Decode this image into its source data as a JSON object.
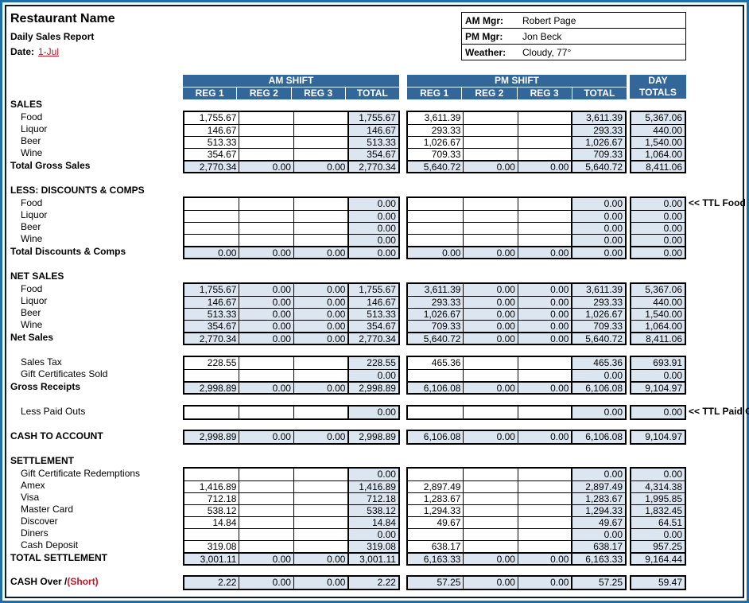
{
  "header": {
    "title": "Restaurant Name",
    "subtitle": "Daily Sales Report",
    "date_label": "Date:",
    "date_value": "1-Jul"
  },
  "info": [
    {
      "key": "AM Mgr:",
      "value": "Robert Page"
    },
    {
      "key": "PM Mgr:",
      "value": "Jon Beck"
    },
    {
      "key": "Weather:",
      "value": "Cloudy, 77°"
    }
  ],
  "columns": {
    "am_shift": "AM SHIFT",
    "pm_shift": "PM SHIFT",
    "day_top": "DAY",
    "day_bottom": "TOTALS",
    "sub": [
      "REG 1",
      "REG 2",
      "REG 3",
      "TOTAL"
    ]
  },
  "colors": {
    "header_bg": "#336699",
    "shade": "#dce6f1",
    "accent_red": "#c0182a",
    "frame": "#1e6fa8"
  },
  "sections": {
    "sales": {
      "heading": "SALES",
      "rows": [
        {
          "label": "Food",
          "am": [
            "1,755.67",
            "",
            "",
            "1,755.67"
          ],
          "pm": [
            "3,611.39",
            "",
            "",
            "3,611.39"
          ],
          "day": "5,367.06"
        },
        {
          "label": "Liquor",
          "am": [
            "146.67",
            "",
            "",
            "146.67"
          ],
          "pm": [
            "293.33",
            "",
            "",
            "293.33"
          ],
          "day": "440.00"
        },
        {
          "label": "Beer",
          "am": [
            "513.33",
            "",
            "",
            "513.33"
          ],
          "pm": [
            "1,026.67",
            "",
            "",
            "1,026.67"
          ],
          "day": "1,540.00"
        },
        {
          "label": "Wine",
          "am": [
            "354.67",
            "",
            "",
            "354.67"
          ],
          "pm": [
            "709.33",
            "",
            "",
            "709.33"
          ],
          "day": "1,064.00"
        }
      ],
      "total": {
        "label": "Total Gross Sales",
        "am": [
          "2,770.34",
          "0.00",
          "0.00",
          "2,770.34"
        ],
        "pm": [
          "5,640.72",
          "0.00",
          "0.00",
          "5,640.72"
        ],
        "day": "8,411.06"
      }
    },
    "discounts": {
      "heading": "LESS: DISCOUNTS & COMPS",
      "note": "<< TTL Food",
      "rows": [
        {
          "label": "Food",
          "am": [
            "",
            "",
            "",
            "0.00"
          ],
          "pm": [
            "",
            "",
            "",
            "0.00"
          ],
          "day": "0.00"
        },
        {
          "label": "Liquor",
          "am": [
            "",
            "",
            "",
            "0.00"
          ],
          "pm": [
            "",
            "",
            "",
            "0.00"
          ],
          "day": "0.00"
        },
        {
          "label": "Beer",
          "am": [
            "",
            "",
            "",
            "0.00"
          ],
          "pm": [
            "",
            "",
            "",
            "0.00"
          ],
          "day": "0.00"
        },
        {
          "label": "Wine",
          "am": [
            "",
            "",
            "",
            "0.00"
          ],
          "pm": [
            "",
            "",
            "",
            "0.00"
          ],
          "day": "0.00"
        }
      ],
      "total": {
        "label": "Total Discounts & Comps",
        "am": [
          "0.00",
          "0.00",
          "0.00",
          "0.00"
        ],
        "pm": [
          "0.00",
          "0.00",
          "0.00",
          "0.00"
        ],
        "day": "0.00"
      }
    },
    "net_sales": {
      "heading": "NET SALES",
      "rows": [
        {
          "label": "Food",
          "am": [
            "1,755.67",
            "0.00",
            "0.00",
            "1,755.67"
          ],
          "pm": [
            "3,611.39",
            "0.00",
            "0.00",
            "3,611.39"
          ],
          "day": "5,367.06"
        },
        {
          "label": "Liquor",
          "am": [
            "146.67",
            "0.00",
            "0.00",
            "146.67"
          ],
          "pm": [
            "293.33",
            "0.00",
            "0.00",
            "293.33"
          ],
          "day": "440.00"
        },
        {
          "label": "Beer",
          "am": [
            "513.33",
            "0.00",
            "0.00",
            "513.33"
          ],
          "pm": [
            "1,026.67",
            "0.00",
            "0.00",
            "1,026.67"
          ],
          "day": "1,540.00"
        },
        {
          "label": "Wine",
          "am": [
            "354.67",
            "0.00",
            "0.00",
            "354.67"
          ],
          "pm": [
            "709.33",
            "0.00",
            "0.00",
            "709.33"
          ],
          "day": "1,064.00"
        }
      ],
      "total": {
        "label": "Net Sales",
        "am": [
          "2,770.34",
          "0.00",
          "0.00",
          "2,770.34"
        ],
        "pm": [
          "5,640.72",
          "0.00",
          "0.00",
          "5,640.72"
        ],
        "day": "8,411.06"
      }
    },
    "receipts": {
      "rows": [
        {
          "label": "Sales Tax",
          "am": [
            "228.55",
            "",
            "",
            "228.55"
          ],
          "pm": [
            "465.36",
            "",
            "",
            "465.36"
          ],
          "day": "693.91"
        },
        {
          "label": "Gift Certificates Sold",
          "am": [
            "",
            "",
            "",
            "0.00"
          ],
          "pm": [
            "",
            "",
            "",
            "0.00"
          ],
          "day": "0.00"
        }
      ],
      "total": {
        "label": "Gross Receipts",
        "am": [
          "2,998.89",
          "0.00",
          "0.00",
          "2,998.89"
        ],
        "pm": [
          "6,106.08",
          "0.00",
          "0.00",
          "6,106.08"
        ],
        "day": "9,104.97"
      }
    },
    "paid_outs": {
      "label": "Less Paid Outs",
      "note": "<< TTL Paid O",
      "am": [
        "",
        "",
        "",
        "0.00"
      ],
      "pm": [
        "",
        "",
        "",
        "0.00"
      ],
      "day": "0.00"
    },
    "cash_to_account": {
      "label": "CASH TO ACCOUNT",
      "am": [
        "2,998.89",
        "0.00",
        "0.00",
        "2,998.89"
      ],
      "pm": [
        "6,106.08",
        "0.00",
        "0.00",
        "6,106.08"
      ],
      "day": "9,104.97"
    },
    "settlement": {
      "heading": "SETTLEMENT",
      "rows": [
        {
          "label": "Gift Certificate Redemptions",
          "am": [
            "",
            "",
            "",
            "0.00"
          ],
          "pm": [
            "",
            "",
            "",
            "0.00"
          ],
          "day": "0.00"
        },
        {
          "label": "Amex",
          "am": [
            "1,416.89",
            "",
            "",
            "1,416.89"
          ],
          "pm": [
            "2,897.49",
            "",
            "",
            "2,897.49"
          ],
          "day": "4,314.38"
        },
        {
          "label": "Visa",
          "am": [
            "712.18",
            "",
            "",
            "712.18"
          ],
          "pm": [
            "1,283.67",
            "",
            "",
            "1,283.67"
          ],
          "day": "1,995.85"
        },
        {
          "label": "Master Card",
          "am": [
            "538.12",
            "",
            "",
            "538.12"
          ],
          "pm": [
            "1,294.33",
            "",
            "",
            "1,294.33"
          ],
          "day": "1,832.45"
        },
        {
          "label": "Discover",
          "am": [
            "14.84",
            "",
            "",
            "14.84"
          ],
          "pm": [
            "49.67",
            "",
            "",
            "49.67"
          ],
          "day": "64.51"
        },
        {
          "label": "Diners",
          "am": [
            "",
            "",
            "",
            "0.00"
          ],
          "pm": [
            "",
            "",
            "",
            "0.00"
          ],
          "day": "0.00"
        },
        {
          "label": "Cash Deposit",
          "am": [
            "319.08",
            "",
            "",
            "319.08"
          ],
          "pm": [
            "638.17",
            "",
            "",
            "638.17"
          ],
          "day": "957.25"
        }
      ],
      "total": {
        "label": "TOTAL SETTLEMENT",
        "am": [
          "3,001.11",
          "0.00",
          "0.00",
          "3,001.11"
        ],
        "pm": [
          "6,163.33",
          "0.00",
          "0.00",
          "6,163.33"
        ],
        "day": "9,164.44"
      }
    },
    "cash_over": {
      "label_main": "CASH Over /",
      "label_red": "(Short)",
      "am": [
        "2.22",
        "0.00",
        "0.00",
        "2.22"
      ],
      "pm": [
        "57.25",
        "0.00",
        "0.00",
        "57.25"
      ],
      "day": "59.47"
    }
  }
}
